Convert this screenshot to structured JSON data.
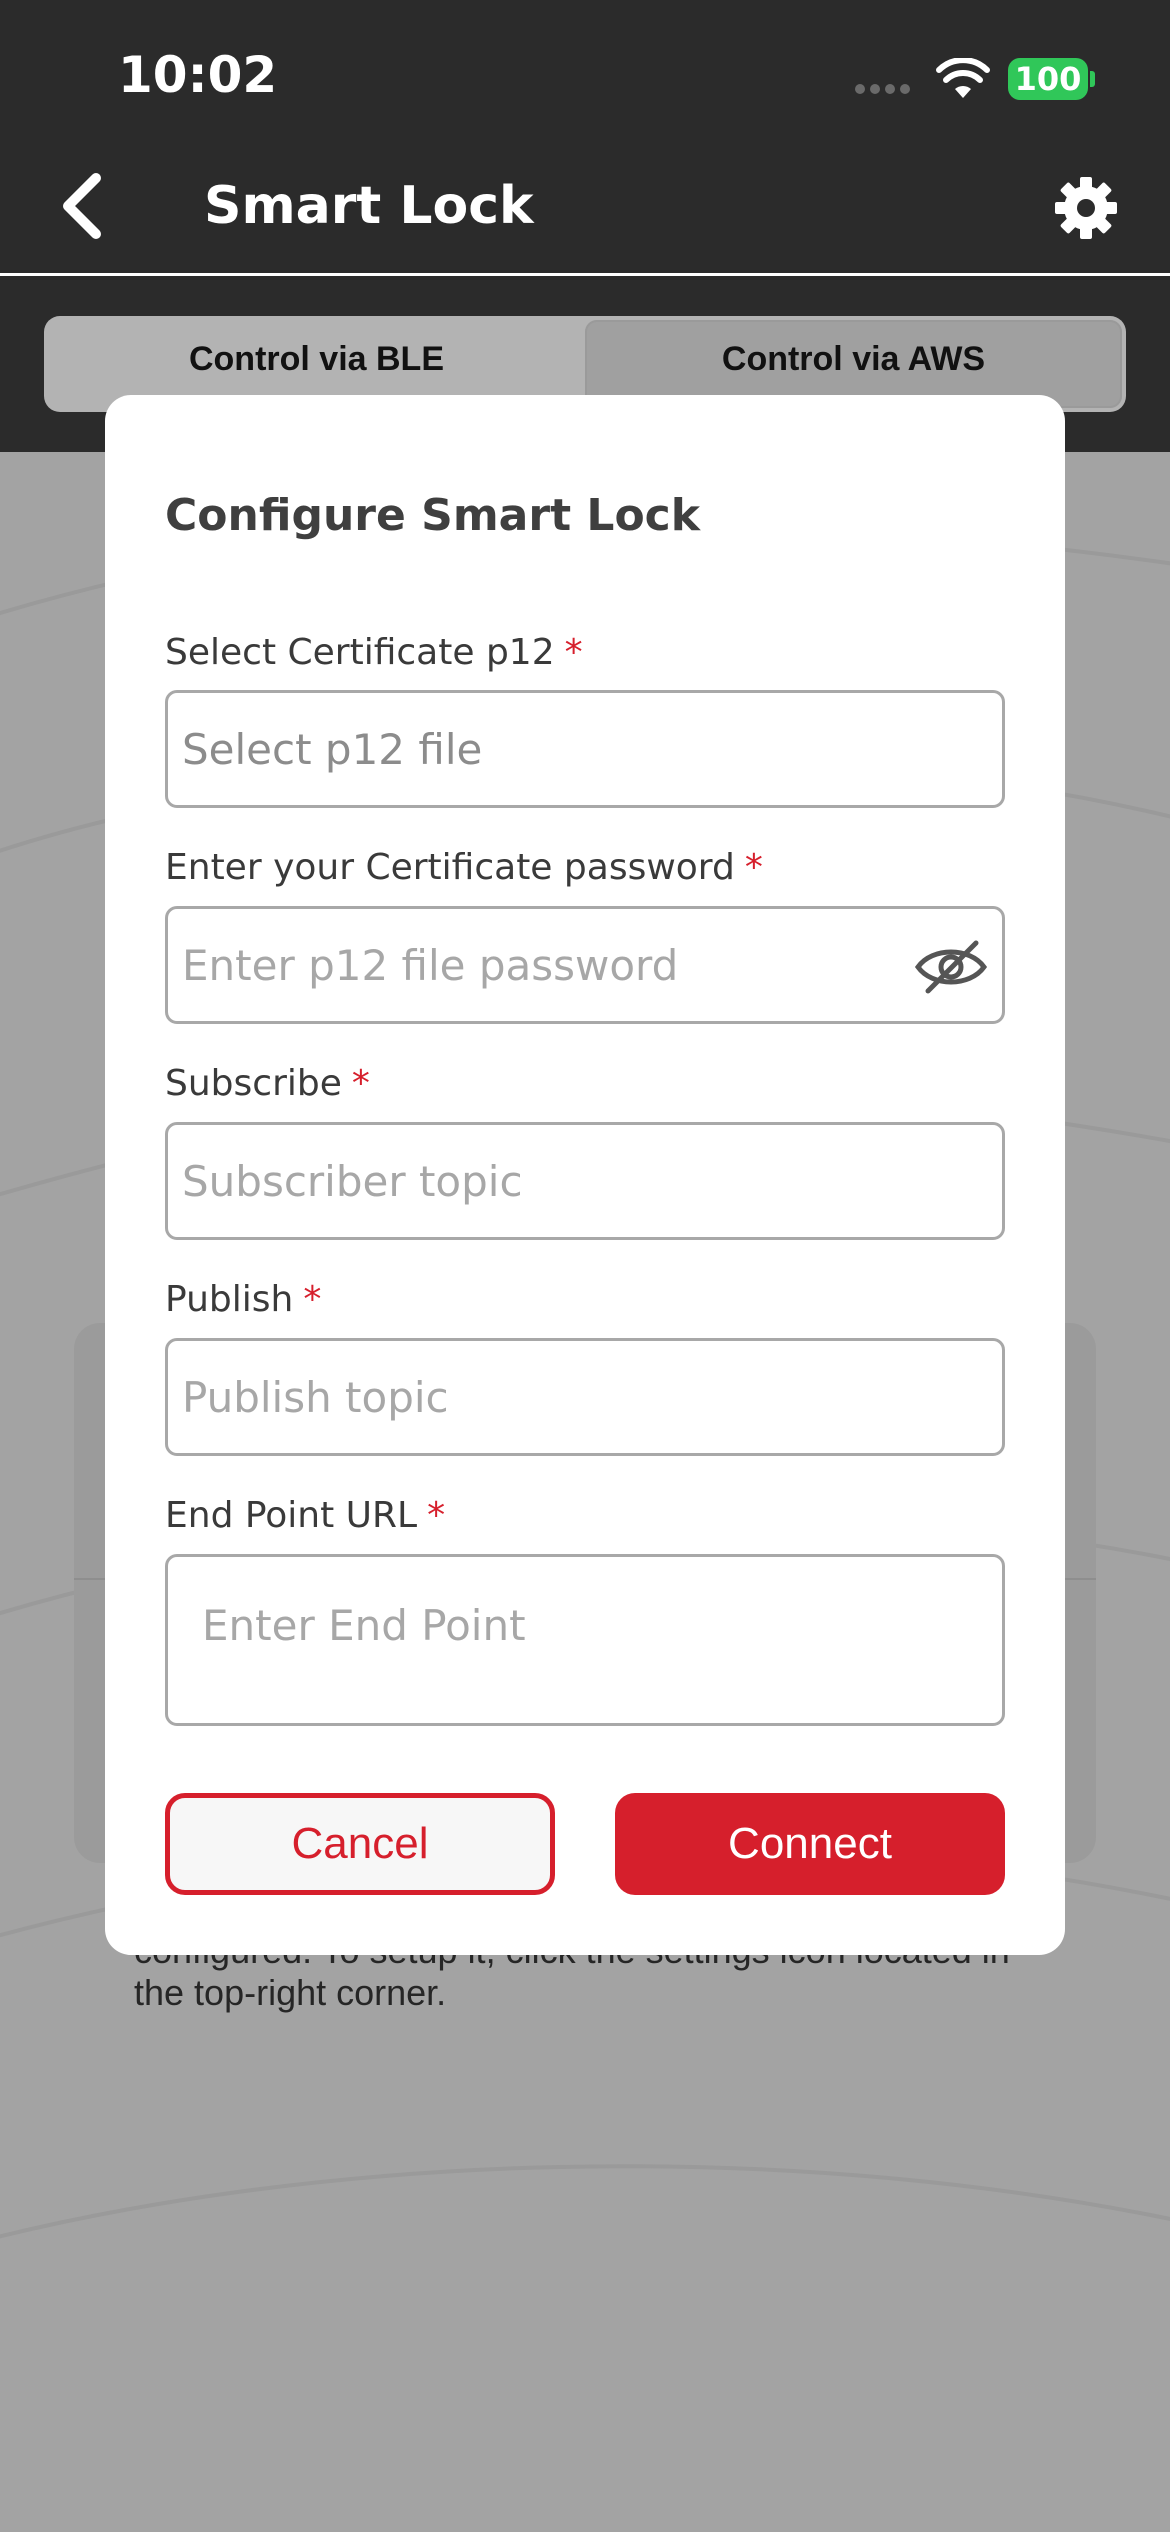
{
  "status_bar": {
    "time": "10:02",
    "battery": "100",
    "icons": [
      "cellular-signal-icon",
      "wifi-icon",
      "battery-icon"
    ]
  },
  "header": {
    "title": "Smart Lock",
    "back_icon": "chevron-left-icon",
    "settings_icon": "gear-icon"
  },
  "tabs": [
    {
      "label": "Control via BLE",
      "selected": false
    },
    {
      "label": "Control via AWS",
      "selected": true
    }
  ],
  "background_info": "configured. To setup it, click the settings icon located in the top-right corner.",
  "modal": {
    "title": "Configure Smart Lock",
    "required_marker": "*",
    "fields": [
      {
        "label": "Select Certificate p12",
        "placeholder": "Select p12 file"
      },
      {
        "label": "Enter your Certificate password",
        "placeholder": "Enter p12 file password",
        "icon": "eye-off-icon"
      },
      {
        "label": "Subscribe",
        "placeholder": "Subscriber topic"
      },
      {
        "label": "Publish",
        "placeholder": "Publish topic"
      },
      {
        "label": "End Point URL",
        "placeholder": "Enter End Point"
      }
    ],
    "cancel_label": "Cancel",
    "connect_label": "Connect"
  },
  "colors": {
    "header_bg": "#2b2b2b",
    "overlay_bg": "#a3a3a3",
    "accent_red": "#d61f2c",
    "battery_green": "#30c759"
  }
}
